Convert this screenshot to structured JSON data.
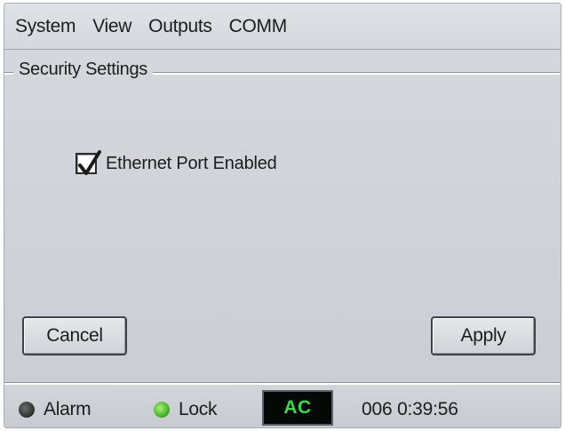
{
  "menubar": {
    "items": [
      {
        "label": "System"
      },
      {
        "label": "View"
      },
      {
        "label": "Outputs"
      },
      {
        "label": "COMM"
      }
    ]
  },
  "section": {
    "title": "Security Settings"
  },
  "ethernet": {
    "label": "Ethernet Port Enabled",
    "checked": true
  },
  "buttons": {
    "cancel_label": "Cancel",
    "apply_label": "Apply"
  },
  "status": {
    "alarm_label": "Alarm",
    "lock_label": "Lock",
    "power_indicator": "AC",
    "time_readout": "006  0:39:56",
    "colors": {
      "alarm_led": "#2d2d2d",
      "lock_led": "#39a81c",
      "power_text": "#3ed84a"
    }
  }
}
